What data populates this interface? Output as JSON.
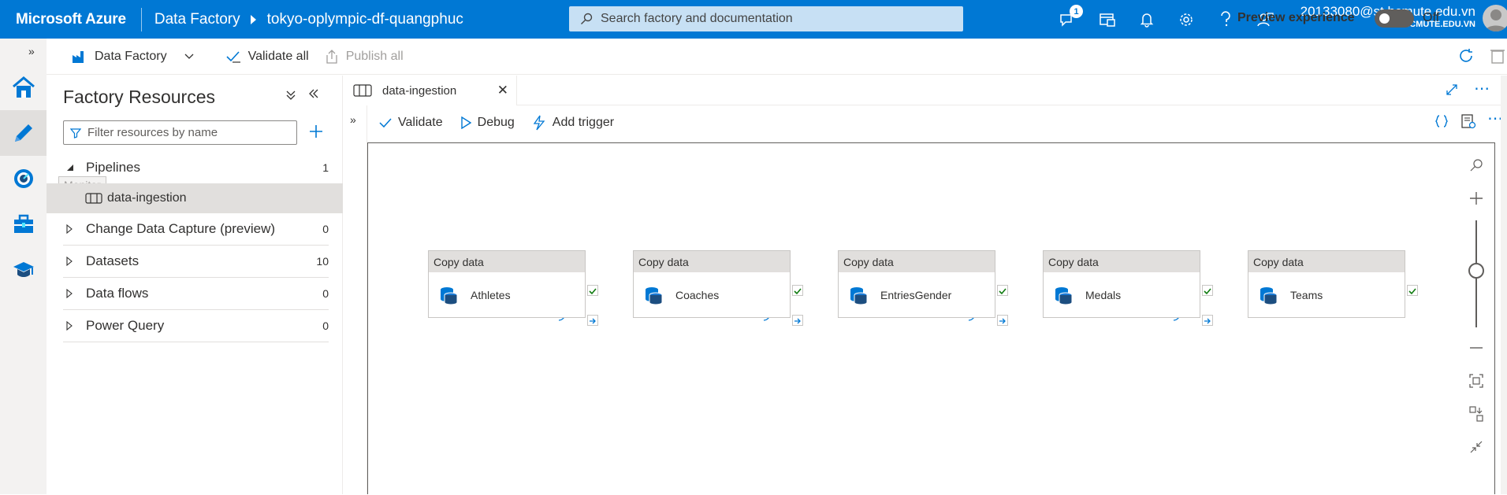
{
  "topbar": {
    "brand": "Microsoft Azure",
    "breadcrumb": [
      "Data Factory",
      "tokyo-oplympic-df-quangphuc"
    ],
    "search_placeholder": "Search factory and documentation",
    "notification_count": "1",
    "account_email": "20133080@st.hcmute.edu.vn",
    "account_org": "HCMUTE.EDU.VN",
    "icons": [
      "feedback-icon",
      "switch-directory-icon",
      "bell-icon",
      "gear-icon",
      "help-icon",
      "support-icon"
    ]
  },
  "rail": {
    "items": [
      "home-icon",
      "author-pencil-icon",
      "monitor-icon",
      "manage-toolbox-icon",
      "learning-hat-icon"
    ],
    "tooltip": "Monitor"
  },
  "toolbar": {
    "factory_label": "Data Factory",
    "validate_all": "Validate all",
    "publish_all": "Publish all",
    "preview_label": "Preview experience",
    "preview_state": "Off"
  },
  "resources": {
    "title": "Factory Resources",
    "filter_placeholder": "Filter resources by name",
    "tree": [
      {
        "label": "Pipelines",
        "count": "1",
        "expanded": true
      },
      {
        "label": "Change Data Capture (preview)",
        "count": "0",
        "expanded": false
      },
      {
        "label": "Datasets",
        "count": "10",
        "expanded": false
      },
      {
        "label": "Data flows",
        "count": "0",
        "expanded": false
      },
      {
        "label": "Power Query",
        "count": "0",
        "expanded": false
      }
    ],
    "pipeline_child": "data-ingestion"
  },
  "editor": {
    "tab_label": "data-ingestion",
    "commands": {
      "validate": "Validate",
      "debug": "Debug",
      "add_trigger": "Add trigger"
    },
    "activities": [
      {
        "type": "Copy data",
        "name": "Athletes"
      },
      {
        "type": "Copy data",
        "name": "Coaches"
      },
      {
        "type": "Copy data",
        "name": "EntriesGender"
      },
      {
        "type": "Copy data",
        "name": "Medals"
      },
      {
        "type": "Copy data",
        "name": "Teams"
      }
    ],
    "zoom_level": 0.5
  },
  "colors": {
    "azure_blue": "#0078d4",
    "success_green": "#107c10"
  }
}
